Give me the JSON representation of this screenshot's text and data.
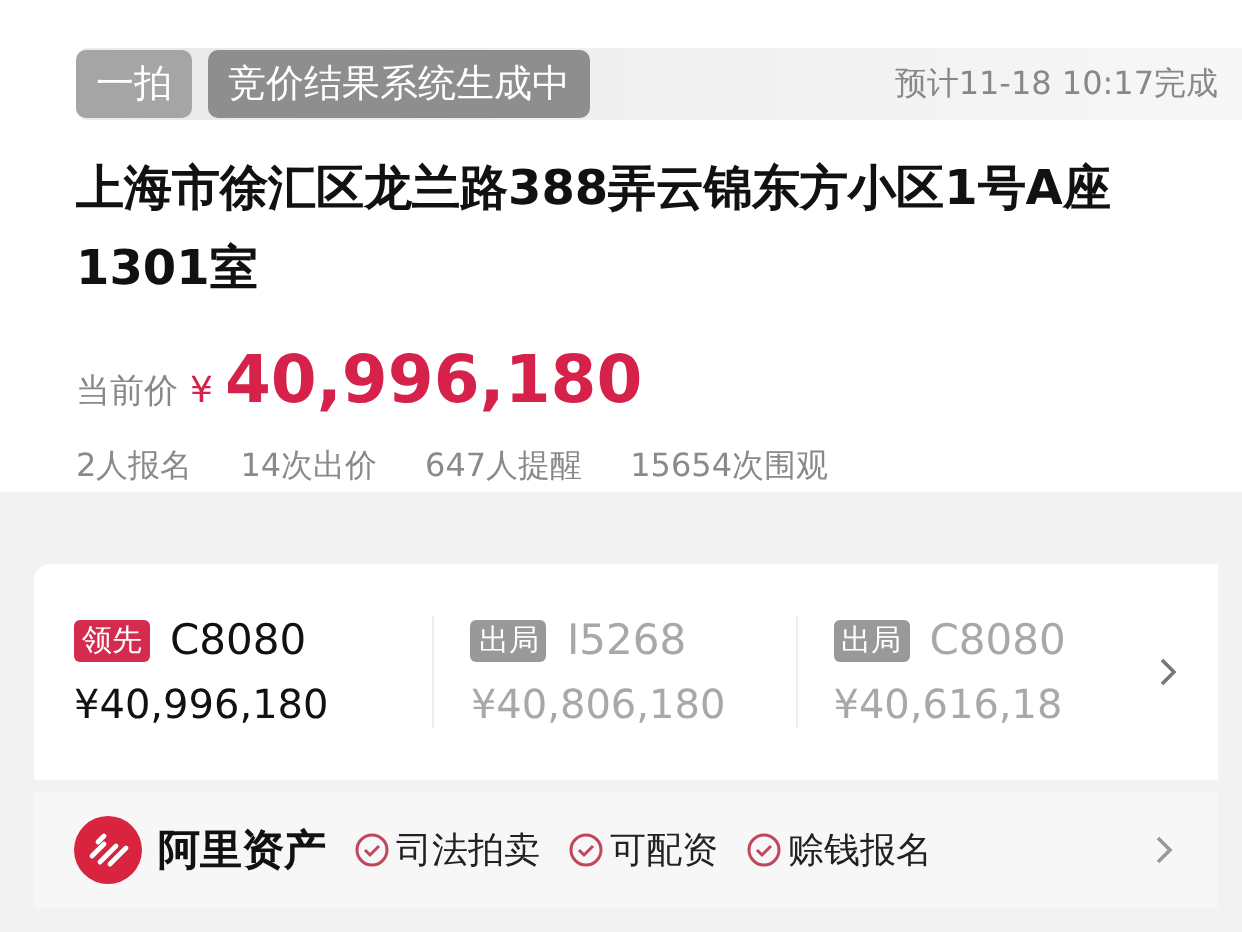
{
  "header": {
    "mode_tag": "一拍",
    "status_tag": "竞价结果系统生成中",
    "eta": "预计11-18 10:17完成"
  },
  "title": "上海市徐汇区龙兰路388弄云锦东方小区1号A座1301室",
  "price": {
    "label": "当前价",
    "currency": "¥",
    "amount": "40,996,180"
  },
  "stats": [
    "2人报名",
    "14次出价",
    "647人提醒",
    "15654次围观"
  ],
  "bids": [
    {
      "kind": "leading",
      "badge": "领先",
      "bidder": "C8080",
      "amount": "¥40,996,180"
    },
    {
      "kind": "out",
      "badge": "出局",
      "bidder": "I5268",
      "amount": "¥40,806,180"
    },
    {
      "kind": "out",
      "badge": "出局",
      "bidder": "C8080",
      "amount": "¥40,616,18"
    }
  ],
  "platform": {
    "name": "阿里资产",
    "features": [
      "司法拍卖",
      "可配资",
      "赊钱报名"
    ]
  }
}
